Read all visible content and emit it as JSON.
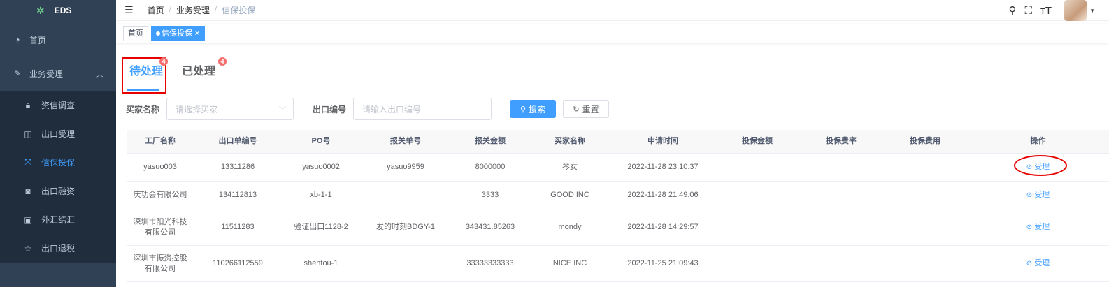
{
  "sidebar": {
    "logo_text": "EDS",
    "items": [
      {
        "label": "首页",
        "icon": "dashboard-icon"
      },
      {
        "label": "业务受理",
        "icon": "edit-icon",
        "expanded": true
      }
    ],
    "subitems": [
      {
        "label": "资信调查",
        "icon": "lock-icon"
      },
      {
        "label": "出口受理",
        "icon": "book-icon"
      },
      {
        "label": "信保投保",
        "icon": "compress-icon",
        "active": true
      },
      {
        "label": "出口融资",
        "icon": "money-icon"
      },
      {
        "label": "外汇结汇",
        "icon": "exchange-icon"
      },
      {
        "label": "出口退税",
        "icon": "star-icon"
      }
    ]
  },
  "header": {
    "breadcrumb": [
      "首页",
      "业务受理",
      "信保投保"
    ]
  },
  "tags": [
    {
      "label": "首页",
      "active": false
    },
    {
      "label": "信保投保",
      "active": true
    }
  ],
  "tabs": [
    {
      "label": "待处理",
      "badge": "4",
      "active": true
    },
    {
      "label": "已处理",
      "badge": "4",
      "active": false
    }
  ],
  "filters": {
    "buyer_label": "买家名称",
    "buyer_placeholder": "请选择买家",
    "export_label": "出口编号",
    "export_placeholder": "请输入出口编号",
    "search_label": "搜索",
    "reset_label": "重置"
  },
  "table": {
    "columns": [
      "工厂名称",
      "出口单编号",
      "PO号",
      "报关单号",
      "报关金额",
      "买家名称",
      "申请时间",
      "投保金额",
      "投保费率",
      "投保费用",
      "操作"
    ],
    "rows": [
      {
        "factory": "yasuo003",
        "export_no": "13311286",
        "po": "yasuo0002",
        "customs_no": "yasuo9959",
        "customs_amount": "8000000",
        "buyer": "琴女",
        "apply_time": "2022-11-28 23:10:37",
        "insured_amount": "",
        "rate": "",
        "fee": "",
        "action": "受理"
      },
      {
        "factory": "庆功会有限公司",
        "export_no": "134112813",
        "po": "xb-1-1",
        "customs_no": "",
        "customs_amount": "3333",
        "buyer": "GOOD INC",
        "apply_time": "2022-11-28 21:49:06",
        "insured_amount": "",
        "rate": "",
        "fee": "",
        "action": "受理"
      },
      {
        "factory": "深圳市阳光科技有限公司",
        "export_no": "11511283",
        "po": "验证出口1128-2",
        "customs_no": "发的时刻BDGY-1",
        "customs_amount": "343431.85263",
        "buyer": "mondy",
        "apply_time": "2022-11-28 14:29:57",
        "insured_amount": "",
        "rate": "",
        "fee": "",
        "action": "受理"
      },
      {
        "factory": "深圳市振资控股有限公司",
        "export_no": "110266112559",
        "po": "shentou-1",
        "customs_no": "",
        "customs_amount": "33333333333",
        "buyer": "NICE INC",
        "apply_time": "2022-11-25 21:09:43",
        "insured_amount": "",
        "rate": "",
        "fee": "",
        "action": "受理"
      }
    ]
  }
}
